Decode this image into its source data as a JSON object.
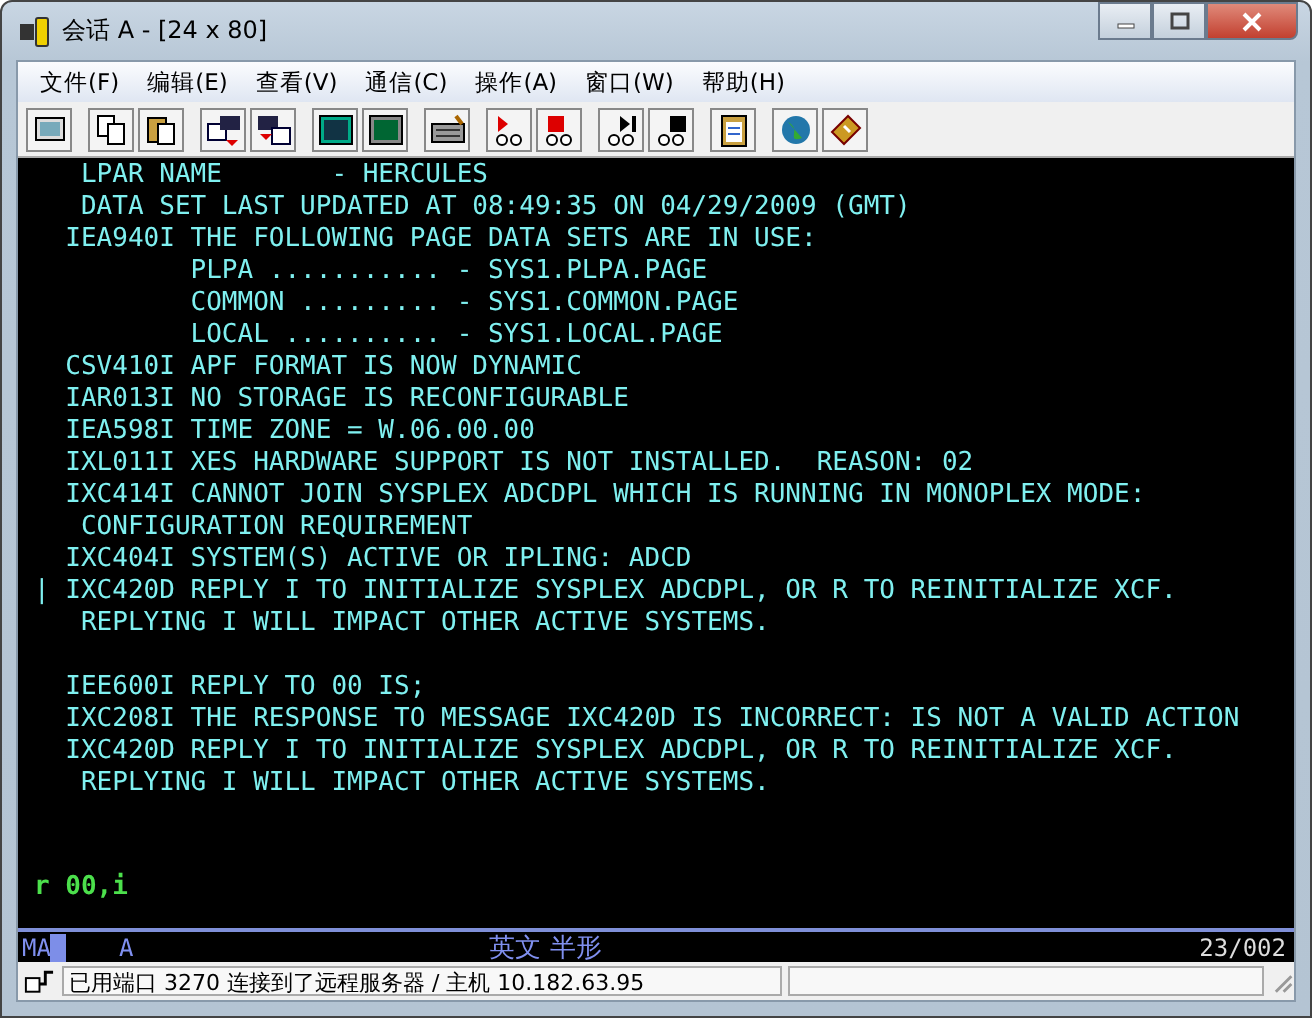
{
  "window": {
    "title": "会话 A - [24 x 80]"
  },
  "menu": [
    "文件(F)",
    "编辑(E)",
    "查看(V)",
    "通信(C)",
    "操作(A)",
    "窗口(W)",
    "帮助(H)"
  ],
  "terminal": {
    "lines": [
      {
        "text": "   LPAR NAME       - HERCULES",
        "blank_line_before": false
      },
      {
        "text": "   DATA SET LAST UPDATED AT 08:49:35 ON 04/29/2009 (GMT)",
        "blank_line_before": false
      },
      {
        "text": "  IEA940I THE FOLLOWING PAGE DATA SETS ARE IN USE:",
        "blank_line_before": false
      },
      {
        "text": "          PLPA ........... - SYS1.PLPA.PAGE",
        "blank_line_before": false
      },
      {
        "text": "          COMMON ......... - SYS1.COMMON.PAGE",
        "blank_line_before": false
      },
      {
        "text": "          LOCAL .......... - SYS1.LOCAL.PAGE",
        "blank_line_before": false
      },
      {
        "text": "  CSV410I APF FORMAT IS NOW DYNAMIC",
        "blank_line_before": false
      },
      {
        "text": "  IAR013I NO STORAGE IS RECONFIGURABLE",
        "blank_line_before": false
      },
      {
        "text": "  IEA598I TIME ZONE = W.06.00.00",
        "blank_line_before": false
      },
      {
        "text": "  IXL011I XES HARDWARE SUPPORT IS NOT INSTALLED.  REASON: 02",
        "blank_line_before": false
      },
      {
        "text": "  IXC414I CANNOT JOIN SYSPLEX ADCDPL WHICH IS RUNNING IN MONOPLEX MODE:",
        "blank_line_before": false
      },
      {
        "text": "   CONFIGURATION REQUIREMENT",
        "blank_line_before": false
      },
      {
        "text": "  IXC404I SYSTEM(S) ACTIVE OR IPLING: ADCD",
        "blank_line_before": false
      },
      {
        "text": "| IXC420D REPLY I TO INITIALIZE SYSPLEX ADCDPL, OR R TO REINITIALIZE XCF.",
        "blank_line_before": false
      },
      {
        "text": "   REPLYING I WILL IMPACT OTHER ACTIVE SYSTEMS.",
        "blank_line_before": false
      },
      {
        "text": "  IEE600I REPLY TO 00 IS;",
        "blank_line_before": true
      },
      {
        "text": "  IXC208I THE RESPONSE TO MESSAGE IXC420D IS INCORRECT: IS NOT A VALID ACTION",
        "blank_line_before": false
      },
      {
        "text": "  IXC420D REPLY I TO INITIALIZE SYSPLEX ADCDPL, OR R TO REINITIALIZE XCF.",
        "blank_line_before": false
      },
      {
        "text": "   REPLYING I WILL IMPACT OTHER ACTIVE SYSTEMS.",
        "blank_line_before": false
      }
    ],
    "command": {
      "value": "r 00,i"
    }
  },
  "operator_info": {
    "mode": "MA",
    "session": "A",
    "input_mode": "英文 半形",
    "cursor": "23/002"
  },
  "status_bar": {
    "message": "已用端口 3270 连接到了远程服务器 / 主机 10.182.63.95"
  }
}
